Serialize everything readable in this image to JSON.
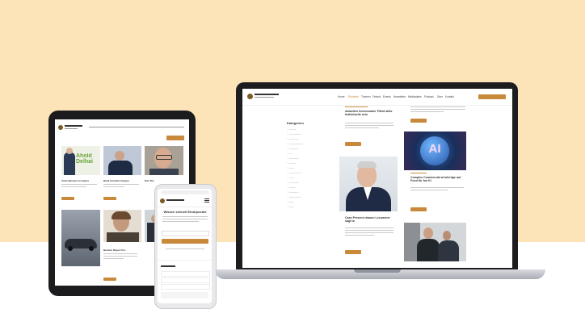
{
  "laptop": {
    "nav_items": [
      "Home",
      "Rubriken",
      "Themen",
      "Fintech",
      "Events",
      "Newsletter",
      "Mediadaten",
      "Podcast",
      "Über",
      "Kontakt"
    ],
    "categories_title": "Kategorien",
    "articles": [
      {
        "title": "Aktuellen Interessante TNeld aktiv Individuelle sein"
      },
      {
        "title": "Case Present chauon Lecumerer sagt to"
      },
      {
        "title": "Complex Commercial at Interlige auf Fond für fun Ki"
      }
    ],
    "ai_tile_text": "AI"
  },
  "tablet": {
    "ad_text": "Ahold Delhai",
    "articles": [
      {
        "title": "Unternehmen ist wieder"
      },
      {
        "title": "Bank Genefire hemper"
      },
      {
        "title": "Kiel The"
      }
    ],
    "bottom_article_title": "Buchen Report Pro"
  },
  "phone": {
    "heading": "Wissen schnell Eindrpockte"
  },
  "colors": {
    "background_band": "#fde3b8",
    "accent": "#c9893a",
    "device_dark": "#1d1d1f"
  }
}
